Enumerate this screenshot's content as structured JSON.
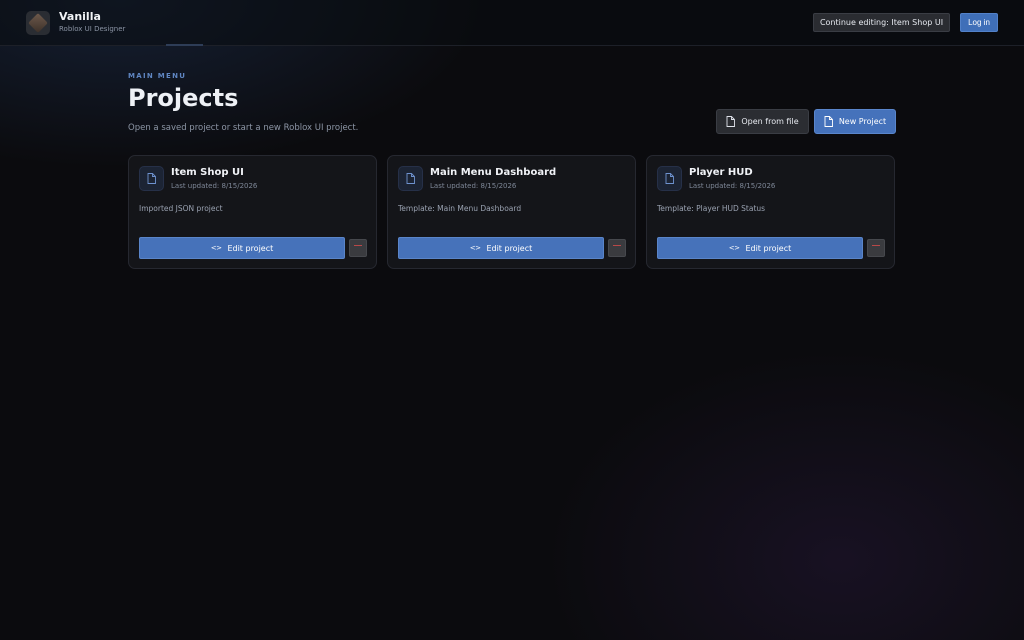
{
  "app": {
    "name": "Vanilla",
    "subtitle": "Roblox UI Designer",
    "logo_icon": "cube-logo-icon"
  },
  "topbar": {
    "continue_label": "Continue editing: Item Shop UI",
    "login_label": "Log in"
  },
  "header": {
    "section_label": "MAIN MENU",
    "title": "Projects",
    "subtitle": "Open a saved project or start a new Roblox UI project.",
    "open_label": "Open from file",
    "new_label": "New Project"
  },
  "projects": [
    {
      "title": "Item Shop UI",
      "updated": "Last updated: 8/15/2026",
      "description": "Imported JSON project",
      "edit_label": "Edit project"
    },
    {
      "title": "Main Menu Dashboard",
      "updated": "Last updated: 8/15/2026",
      "description": "Template: Main Menu Dashboard",
      "edit_label": "Edit project"
    },
    {
      "title": "Player HUD",
      "updated": "Last updated: 8/15/2026",
      "description": "Template: Player HUD Status",
      "edit_label": "Edit project"
    }
  ],
  "colors": {
    "accent": "#4572bb",
    "background": "#0b0b0e",
    "card": "#141519",
    "danger": "#b84848"
  }
}
